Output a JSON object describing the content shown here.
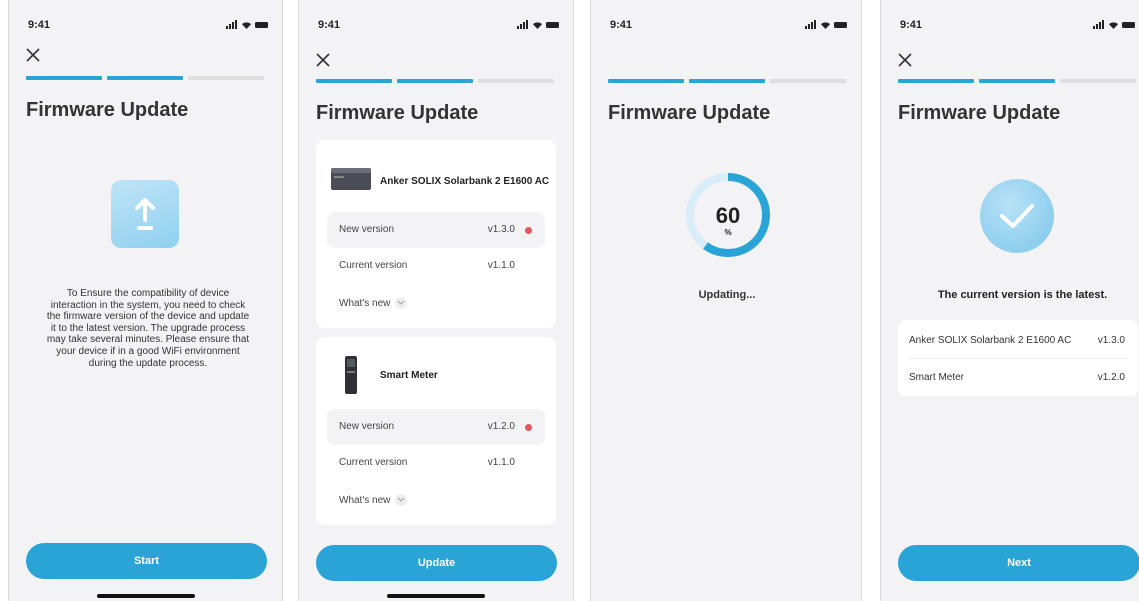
{
  "status_time": "9:41",
  "screen_title": "Firmware Update",
  "colors": {
    "accent": "#2aa3d6",
    "dot": "#e3565b",
    "bg": "#f3f3f5"
  },
  "screen1": {
    "progress_steps": [
      true,
      true,
      false
    ],
    "icon": "upload-icon",
    "description": "To Ensure the compatibility of device interaction in the system, you need to check the firmware version of the device and update it to the latest version. The upgrade process may take several minutes. Please ensure that your device if in a good WiFi environment during the update process.",
    "button": "Start"
  },
  "screen2": {
    "progress_steps": [
      true,
      true,
      false
    ],
    "devices": [
      {
        "name": "Anker SOLIX Solarbank 2 E1600 AC",
        "icon": "solarbank-device-icon",
        "new_label": "New version",
        "new_value": "v1.3.0",
        "current_label": "Current version",
        "current_value": "v1.1.0",
        "whats_new": "What's new"
      },
      {
        "name": "Smart Meter",
        "icon": "smart-meter-icon",
        "new_label": "New version",
        "new_value": "v1.2.0",
        "current_label": "Current version",
        "current_value": "v1.1.0",
        "whats_new": "What's new"
      }
    ],
    "button": "Update"
  },
  "screen3": {
    "progress_steps": [
      true,
      true,
      false
    ],
    "percent": "60",
    "progress_fraction": 0.6,
    "unit": "%",
    "status": "Updating..."
  },
  "screen4": {
    "progress_steps": [
      true,
      true,
      false
    ],
    "icon": "check-icon",
    "message": "The current version is the latest.",
    "items": [
      {
        "name": "Anker SOLIX Solarbank 2 E1600 AC",
        "version": "v1.3.0"
      },
      {
        "name": "Smart Meter",
        "version": "v1.2.0"
      }
    ],
    "button": "Next"
  }
}
